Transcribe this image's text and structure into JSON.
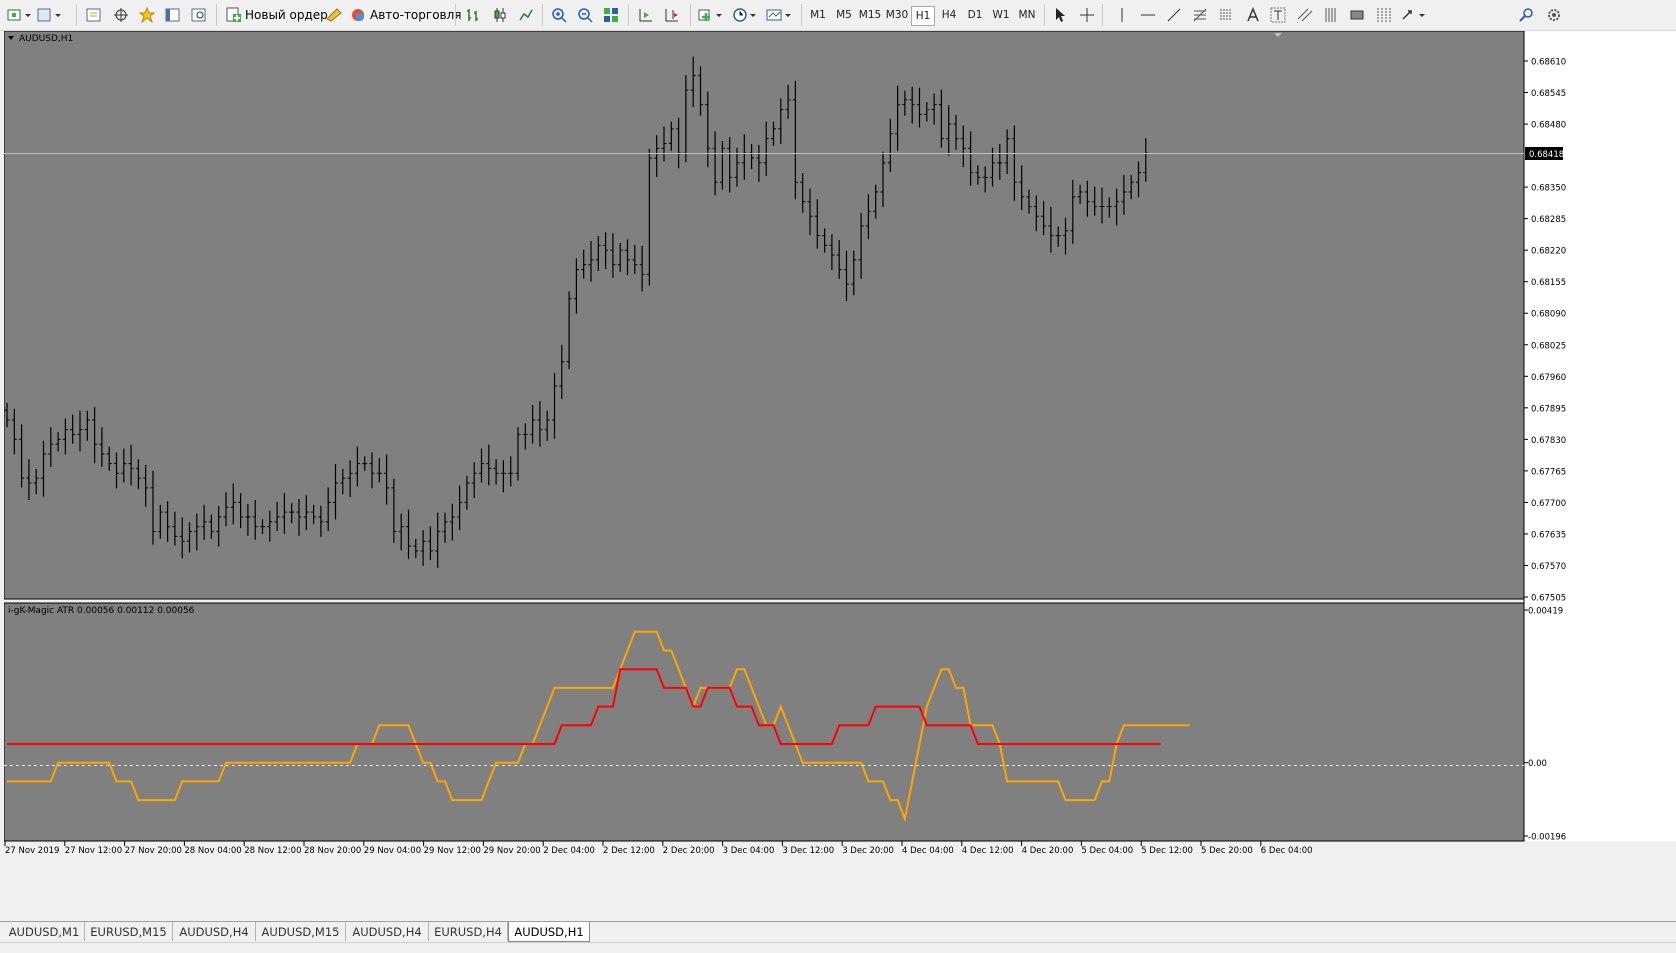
{
  "toolbar": {
    "new_order_label": "Новый ордер",
    "auto_trading_label": "Авто-торговля",
    "timeframes": [
      "M1",
      "M5",
      "M15",
      "M30",
      "H1",
      "H4",
      "D1",
      "W1",
      "MN"
    ],
    "active_timeframe": "H1"
  },
  "main_chart": {
    "symbol_label": "AUDUSD,H1",
    "current_price_label": "0.68418",
    "price_axis_labels": [
      "0.68610",
      "0.68545",
      "0.68480",
      "0.68350",
      "0.68285",
      "0.68220",
      "0.68155",
      "0.68090",
      "0.68025",
      "0.67960",
      "0.67895",
      "0.67830",
      "0.67765",
      "0.67700",
      "0.67635",
      "0.67570",
      "0.67505"
    ]
  },
  "indicator": {
    "label": "i-gK-Magic ATR 0.00056 0.00112 0.00056",
    "axis_labels": [
      "0.00419",
      "0.00",
      "-0.00196"
    ]
  },
  "time_axis_labels": [
    "27 Nov 2019",
    "27 Nov 12:00",
    "27 Nov 20:00",
    "28 Nov 04:00",
    "28 Nov 12:00",
    "28 Nov 20:00",
    "29 Nov 04:00",
    "29 Nov 12:00",
    "29 Nov 20:00",
    "2 Dec 04:00",
    "2 Dec 12:00",
    "2 Dec 20:00",
    "3 Dec 04:00",
    "3 Dec 12:00",
    "3 Dec 20:00",
    "4 Dec 04:00",
    "4 Dec 12:00",
    "4 Dec 20:00",
    "5 Dec 04:00",
    "5 Dec 12:00",
    "5 Dec 20:00",
    "6 Dec 04:00"
  ],
  "tabs": [
    "AUDUSD,M1",
    "EURUSD,M15",
    "AUDUSD,H4",
    "AUDUSD,M15",
    "AUDUSD,H4",
    "EURUSD,H4",
    "AUDUSD,H1"
  ],
  "active_tab": "AUDUSD,H1",
  "colors": {
    "chart_bg": "#808080",
    "bars": "#000000",
    "price_line": "#c0c0c0",
    "atr_orange": "#ffa500",
    "atr_red": "#ff0000"
  },
  "chart_data": {
    "type": "line",
    "price_range": [
      0.67505,
      0.6861
    ],
    "closes": [
      0.6787,
      0.6783,
      0.6775,
      0.6774,
      0.6775,
      0.678,
      0.6782,
      0.6783,
      0.6785,
      0.6784,
      0.6785,
      0.6787,
      0.6782,
      0.678,
      0.6778,
      0.6776,
      0.6778,
      0.6777,
      0.6775,
      0.6773,
      0.6764,
      0.6768,
      0.6765,
      0.6763,
      0.6762,
      0.6764,
      0.6765,
      0.6766,
      0.6764,
      0.6767,
      0.6769,
      0.677,
      0.6767,
      0.6767,
      0.6765,
      0.6765,
      0.6766,
      0.6767,
      0.6768,
      0.6768,
      0.6767,
      0.6768,
      0.6767,
      0.6766,
      0.677,
      0.6774,
      0.6775,
      0.6776,
      0.6778,
      0.6778,
      0.6776,
      0.6776,
      0.6773,
      0.6764,
      0.6765,
      0.6761,
      0.676,
      0.6762,
      0.676,
      0.6764,
      0.6766,
      0.6767,
      0.677,
      0.6774,
      0.6776,
      0.6778,
      0.6777,
      0.6776,
      0.6776,
      0.6776,
      0.6784,
      0.6784,
      0.6787,
      0.6785,
      0.6787,
      0.6794,
      0.6799,
      0.6812,
      0.6818,
      0.6819,
      0.682,
      0.6823,
      0.6822,
      0.6819,
      0.6822,
      0.682,
      0.6819,
      0.6817,
      0.6841,
      0.6843,
      0.6844,
      0.6847,
      0.6842,
      0.6855,
      0.6858,
      0.6852,
      0.6843,
      0.6836,
      0.6843,
      0.6837,
      0.684,
      0.6842,
      0.6841,
      0.684,
      0.6845,
      0.6847,
      0.6851,
      0.6853,
      0.6836,
      0.6832,
      0.6829,
      0.6825,
      0.6823,
      0.6821,
      0.6818,
      0.6815,
      0.682,
      0.6827,
      0.683,
      0.6834,
      0.684,
      0.6846,
      0.6852,
      0.6853,
      0.6852,
      0.685,
      0.6851,
      0.6852,
      0.6845,
      0.6848,
      0.6845,
      0.6843,
      0.6838,
      0.6837,
      0.6837,
      0.684,
      0.684,
      0.6845,
      0.6836,
      0.6833,
      0.6831,
      0.6829,
      0.6827,
      0.6825,
      0.6825,
      0.6826,
      0.6833,
      0.6834,
      0.6832,
      0.6831,
      0.6831,
      0.6831,
      0.6832,
      0.6834,
      0.6836,
      0.6838,
      0.6842
    ],
    "atr_orange": [
      -0.0005,
      -0.0005,
      -0.0005,
      -0.0005,
      -0.0005,
      -0.0005,
      -0.0005,
      0.0,
      0.0,
      0.0,
      0.0,
      0.0,
      0.0,
      0.0,
      0.0,
      -0.0005,
      -0.0005,
      -0.0005,
      -0.001,
      -0.001,
      -0.001,
      -0.001,
      -0.001,
      -0.001,
      -0.0005,
      -0.0005,
      -0.0005,
      -0.0005,
      -0.0005,
      -0.0005,
      0.0,
      0.0,
      0.0,
      0.0,
      0.0,
      0.0,
      0.0,
      0.0,
      0.0,
      0.0,
      0.0,
      0.0,
      0.0,
      0.0,
      0.0,
      0.0,
      0.0,
      0.0,
      0.0005,
      0.0005,
      0.0005,
      0.001,
      0.001,
      0.001,
      0.001,
      0.001,
      0.0005,
      0.0,
      0.0,
      -0.0005,
      -0.0005,
      -0.001,
      -0.001,
      -0.001,
      -0.001,
      -0.001,
      -0.0005,
      0.0,
      0.0,
      0.0,
      0.0,
      0.0005,
      0.0005,
      0.001,
      0.0015,
      0.002,
      0.002,
      0.002,
      0.002,
      0.002,
      0.002,
      0.002,
      0.002,
      0.002,
      0.0025,
      0.003,
      0.0035,
      0.0035,
      0.0035,
      0.0035,
      0.003,
      0.003,
      0.0025,
      0.002,
      0.0015,
      0.002,
      0.002,
      0.002,
      0.002,
      0.002,
      0.0025,
      0.0025,
      0.002,
      0.0015,
      0.001,
      0.001,
      0.0015,
      0.001,
      0.0005,
      0.0,
      0.0,
      0.0,
      0.0,
      0.0,
      0.0,
      0.0,
      0.0,
      0.0,
      -0.0005,
      -0.0005,
      -0.0005,
      -0.001,
      -0.001,
      -0.0015,
      -0.0005,
      0.0005,
      0.0015,
      0.002,
      0.0025,
      0.0025,
      0.002,
      0.002,
      0.001,
      0.001,
      0.001,
      0.001,
      0.0005,
      -0.0005,
      -0.0005,
      -0.0005,
      -0.0005,
      -0.0005,
      -0.0005,
      -0.0005,
      -0.0005,
      -0.001,
      -0.001,
      -0.001,
      -0.001,
      -0.001,
      -0.0005,
      -0.0005,
      0.0005,
      0.001,
      0.001,
      0.001,
      0.001,
      0.001,
      0.001,
      0.001,
      0.001,
      0.001,
      0.001
    ],
    "atr_red": [
      0.0005,
      0.0005,
      0.0005,
      0.0005,
      0.0005,
      0.0005,
      0.0005,
      0.0005,
      0.0005,
      0.0005,
      0.0005,
      0.0005,
      0.0005,
      0.0005,
      0.0005,
      0.0005,
      0.0005,
      0.0005,
      0.0005,
      0.0005,
      0.0005,
      0.0005,
      0.0005,
      0.0005,
      0.0005,
      0.0005,
      0.0005,
      0.0005,
      0.0005,
      0.0005,
      0.0005,
      0.0005,
      0.0005,
      0.0005,
      0.0005,
      0.0005,
      0.0005,
      0.0005,
      0.0005,
      0.0005,
      0.0005,
      0.0005,
      0.0005,
      0.0005,
      0.0005,
      0.0005,
      0.0005,
      0.0005,
      0.0005,
      0.0005,
      0.0005,
      0.0005,
      0.0005,
      0.0005,
      0.0005,
      0.0005,
      0.0005,
      0.0005,
      0.0005,
      0.0005,
      0.0005,
      0.0005,
      0.0005,
      0.0005,
      0.0005,
      0.0005,
      0.0005,
      0.0005,
      0.0005,
      0.0005,
      0.0005,
      0.0005,
      0.0005,
      0.0005,
      0.0005,
      0.0005,
      0.001,
      0.001,
      0.001,
      0.001,
      0.001,
      0.0015,
      0.0015,
      0.0015,
      0.0025,
      0.0025,
      0.0025,
      0.0025,
      0.0025,
      0.0025,
      0.002,
      0.002,
      0.002,
      0.002,
      0.0015,
      0.0015,
      0.002,
      0.002,
      0.002,
      0.002,
      0.0015,
      0.0015,
      0.0015,
      0.001,
      0.001,
      0.001,
      0.0005,
      0.0005,
      0.0005,
      0.0005,
      0.0005,
      0.0005,
      0.0005,
      0.0005,
      0.001,
      0.001,
      0.001,
      0.001,
      0.001,
      0.0015,
      0.0015,
      0.0015,
      0.0015,
      0.0015,
      0.0015,
      0.0015,
      0.001,
      0.001,
      0.001,
      0.001,
      0.001,
      0.001,
      0.001,
      0.0005,
      0.0005,
      0.0005,
      0.0005,
      0.0005,
      0.0005,
      0.0005,
      0.0005,
      0.0005,
      0.0005,
      0.0005,
      0.0005,
      0.0005,
      0.0005,
      0.0005,
      0.0005,
      0.0005,
      0.0005,
      0.0005,
      0.0005,
      0.0005,
      0.0005,
      0.0005,
      0.0005,
      0.0005,
      0.0005
    ]
  }
}
